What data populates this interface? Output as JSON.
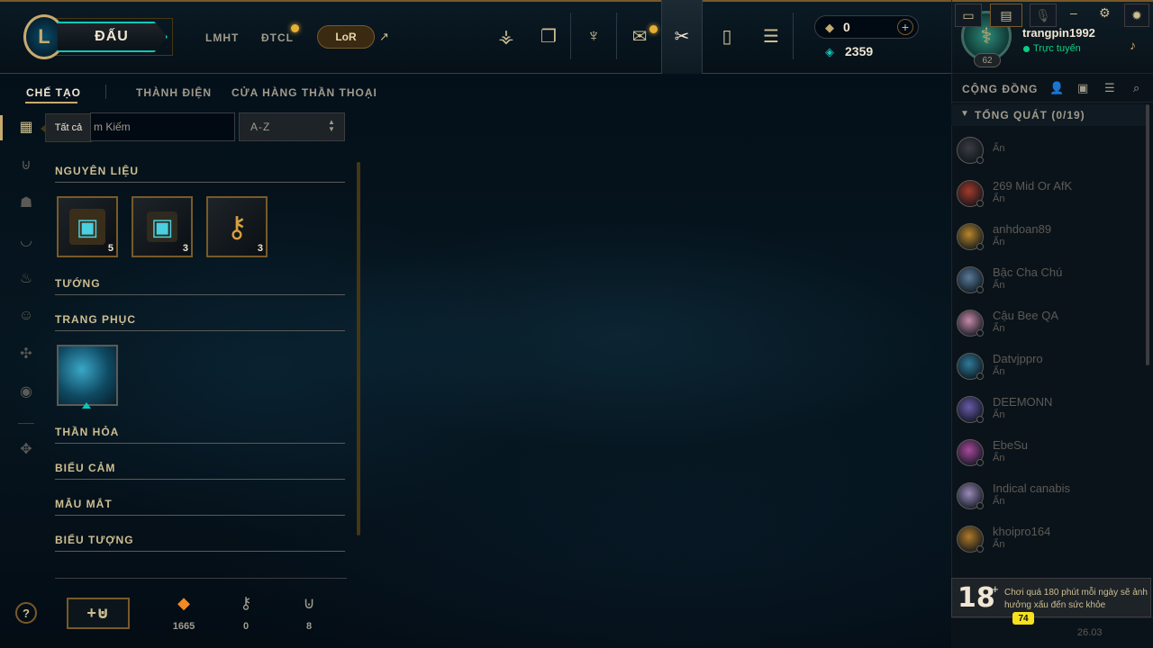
{
  "header": {
    "play_label": "ĐẤU",
    "nav": [
      "LMHT",
      "ĐTCL"
    ],
    "lor_label": "LoR",
    "lor_ext_icon": "↗"
  },
  "currency": {
    "rp_value": "0",
    "be_value": "2359"
  },
  "profile": {
    "username": "trangpin1992",
    "status": "Trực tuyến",
    "level": "62"
  },
  "window_controls": [
    "?",
    "–",
    "⚙",
    "✕"
  ],
  "subnav": {
    "tabs": [
      "CHẾ TẠO",
      "THÀNH ĐIỆN",
      "CỬA HÀNG THẦN THOẠI"
    ]
  },
  "filter": {
    "tooltip": "Tất cả",
    "search_text": "m Kiếm",
    "sort_value": "A-Z"
  },
  "categories": [
    {
      "label": "NGUYÊN LIỆU"
    },
    {
      "label": "TƯỚNG"
    },
    {
      "label": "TRANG PHỤC"
    },
    {
      "label": "THẦN HỎA"
    },
    {
      "label": "BIỂU CẢM"
    },
    {
      "label": "MẪU MẮT"
    },
    {
      "label": "BIỂU TƯỢNG"
    }
  ],
  "materials": [
    {
      "name": "hextech-chest-icon",
      "count": "5"
    },
    {
      "name": "hextech-chest-small-icon",
      "count": "3"
    },
    {
      "name": "hextech-key-icon",
      "count": "3"
    }
  ],
  "resources": [
    {
      "icon": "orange-essence-icon",
      "value": "1665"
    },
    {
      "icon": "key-fragment-icon",
      "value": "0"
    },
    {
      "icon": "chest-icon",
      "value": "8"
    }
  ],
  "social": {
    "title": "CỘNG ĐỒNG",
    "group_label": "TỔNG QUÁT (0/19)",
    "friends": [
      {
        "name": "",
        "status": "Ẩn",
        "color": "#3c3c41"
      },
      {
        "name": "269 Mid Or AfK",
        "status": "Ẩn",
        "color": "#a33a2a"
      },
      {
        "name": "anhdoan89",
        "status": "Ẩn",
        "color": "#b8862a"
      },
      {
        "name": "Bậc Cha Chú",
        "status": "Ẩn",
        "color": "#5a7a9a"
      },
      {
        "name": "Cậu Bee QA",
        "status": "Ẩn",
        "color": "#c78aa8"
      },
      {
        "name": "Datvjppro",
        "status": "Ẩn",
        "color": "#2f7a9a"
      },
      {
        "name": "DEEMONN",
        "status": "Ẩn",
        "color": "#6a5aa8"
      },
      {
        "name": "EbeSu",
        "status": "Ẩn",
        "color": "#a84a9a"
      },
      {
        "name": "Indical canabis",
        "status": "Ẩn",
        "color": "#9a8ab8"
      },
      {
        "name": "khoipro164",
        "status": "Ẩn",
        "color": "#b07a2a"
      }
    ]
  },
  "notice": {
    "age": "18",
    "plus": "+",
    "text": "Chơi quá 180 phút mỗi ngày sẽ ảnh hưởng xấu đến sức khỏe"
  },
  "bottombar": {
    "badge": "74",
    "version": "26.03"
  }
}
